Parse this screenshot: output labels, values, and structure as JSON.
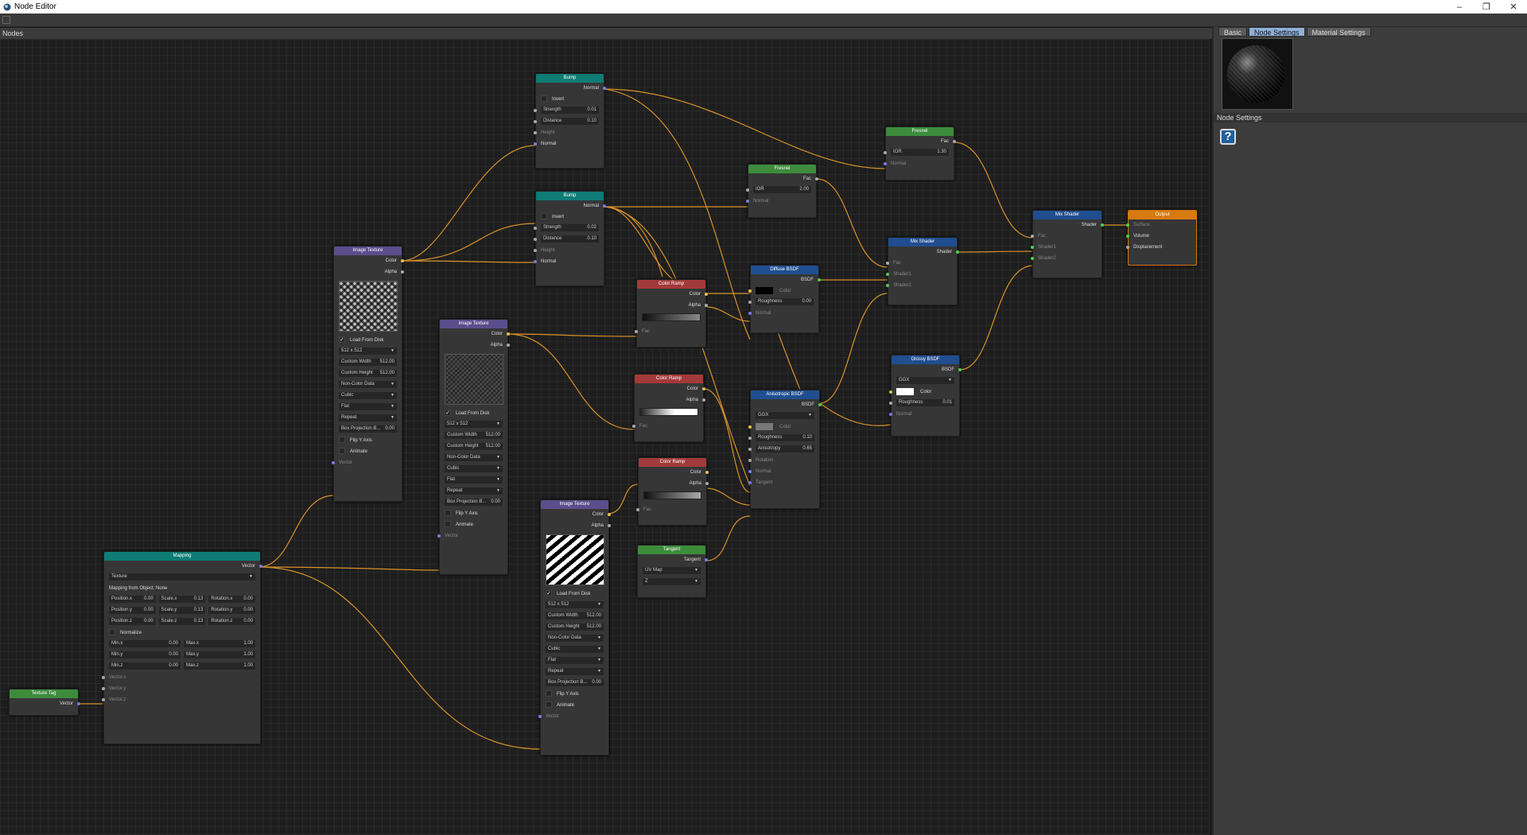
{
  "window": {
    "title": "Node Editor",
    "minimize": "–",
    "maximize": "❐",
    "close": "✕"
  },
  "canvas": {
    "header": "Nodes"
  },
  "right_panel": {
    "tabs": [
      "Basic",
      "Node Settings",
      "Material Settings"
    ],
    "active_tab": "Node Settings",
    "section_title": "Node Settings"
  },
  "nodes": {
    "bump1": {
      "title": "Bump",
      "out": "Normal",
      "invert": "Invert",
      "strength": "Strength",
      "strength_val": "0.01",
      "distance": "Distance",
      "distance_val": "0.10",
      "height": "Height",
      "normal": "Normal"
    },
    "bump2": {
      "title": "Bump",
      "out": "Normal",
      "invert": "Invert",
      "strength": "Strength",
      "strength_val": "0.02",
      "distance": "Distance",
      "distance_val": "0.10",
      "height": "Height",
      "normal": "Normal"
    },
    "fresnel1": {
      "title": "Fresnel",
      "out": "Fac",
      "ior": "IOR",
      "ior_val": "1.30",
      "normal": "Normal"
    },
    "fresnel2": {
      "title": "Fresnel",
      "out": "Fac",
      "ior": "IOR",
      "ior_val": "2.00",
      "normal": "Normal"
    },
    "mix1": {
      "title": "Mix Shader",
      "out": "Shader",
      "fac": "Fac",
      "s1": "Shader1",
      "s2": "Shader2"
    },
    "mix2": {
      "title": "Mix Shader",
      "out": "Shader",
      "fac": "Fac",
      "s1": "Shader1",
      "s2": "Shader2"
    },
    "output": {
      "title": "Output",
      "surface": "Surface",
      "volume": "Volume",
      "displacement": "Displacement"
    },
    "diffuse": {
      "title": "Diffuse BSDF",
      "out": "BSDF",
      "color": "Color",
      "roughness": "Roughness",
      "roughness_val": "0.00",
      "normal": "Normal"
    },
    "glossy": {
      "title": "Glossy BSDF",
      "out": "BSDF",
      "dist": "GGX",
      "color": "Color",
      "roughness": "Roughness",
      "roughness_val": "0.01",
      "normal": "Normal"
    },
    "aniso": {
      "title": "Anisotropic BSDF",
      "out": "BSDF",
      "dist": "GGX",
      "color": "Color",
      "roughness": "Roughness",
      "roughness_val": "0.10",
      "anisotropy": "Anisotropy",
      "anisotropy_val": "0.65",
      "rotation": "Rotation",
      "normal": "Normal",
      "tangent": "Tangent"
    },
    "ramp1": {
      "title": "Color Ramp",
      "color": "Color",
      "alpha": "Alpha",
      "fac": "Fac"
    },
    "ramp2": {
      "title": "Color Ramp",
      "color": "Color",
      "alpha": "Alpha",
      "fac": "Fac"
    },
    "ramp3": {
      "title": "Color Ramp",
      "color": "Color",
      "alpha": "Alpha",
      "fac": "Fac"
    },
    "tangent": {
      "title": "Tangent",
      "out": "Tangent",
      "mode": "UV Map",
      "axis": "Z"
    },
    "tex1": {
      "title": "Image Texture",
      "color": "Color",
      "alpha": "Alpha",
      "load": "Load From Disk",
      "size": "512 x 512",
      "cw": "Custom Width",
      "cw_val": "512.00",
      "ch": "Custom Height",
      "ch_val": "512.00",
      "colordata": "Non-Color Data",
      "interp": "Cubic",
      "proj": "Flat",
      "ext": "Repeat",
      "box": "Box Projection B...",
      "box_val": "0.00",
      "flip": "Flip Y Axis",
      "animate": "Animate",
      "vector": "Vector"
    },
    "tex2": {
      "title": "Image Texture",
      "color": "Color",
      "alpha": "Alpha",
      "load": "Load From Disk",
      "size": "512 x 512",
      "cw": "Custom Width",
      "cw_val": "512.00",
      "ch": "Custom Height",
      "ch_val": "512.00",
      "colordata": "Non-Color Data",
      "interp": "Cubic",
      "proj": "Flat",
      "ext": "Repeat",
      "box": "Box Projection B...",
      "box_val": "0.00",
      "flip": "Flip Y Axis",
      "animate": "Animate",
      "vector": "Vector"
    },
    "tex3": {
      "title": "Image Texture",
      "color": "Color",
      "alpha": "Alpha",
      "load": "Load From Disk",
      "size": "512 x 512",
      "cw": "Custom Width",
      "cw_val": "512.00",
      "ch": "Custom Height",
      "ch_val": "512.00",
      "colordata": "Non-Color Data",
      "interp": "Cubic",
      "proj": "Flat",
      "ext": "Repeat",
      "box": "Box Projection B...",
      "box_val": "0.00",
      "flip": "Flip Y Axis",
      "animate": "Animate",
      "vector": "Vector"
    },
    "mapping": {
      "title": "Mapping",
      "out": "Vector",
      "type": "Texture",
      "from": "Mapping from Object: None",
      "px": "Position.x",
      "py": "Position.y",
      "pz": "Position.z",
      "pval": "0.00",
      "sx": "Scale.x",
      "sy": "Scale.y",
      "sz": "Scale.z",
      "sval": "0.13",
      "rx": "Rotation.x",
      "ry": "Rotation.y",
      "rz": "Rotation.z",
      "rval": "0.00",
      "normalize": "Normalize",
      "minx": "Min.x",
      "miny": "Min.y",
      "minz": "Min.z",
      "minval": "0.00",
      "maxx": "Max.x",
      "maxy": "Max.y",
      "maxz": "Max.z",
      "maxval": "1.00",
      "vx": "Vector.x",
      "vy": "Vector.y",
      "vz": "Vector.z"
    },
    "texturetag": {
      "title": "Texture Tag",
      "out": "Vector"
    }
  }
}
